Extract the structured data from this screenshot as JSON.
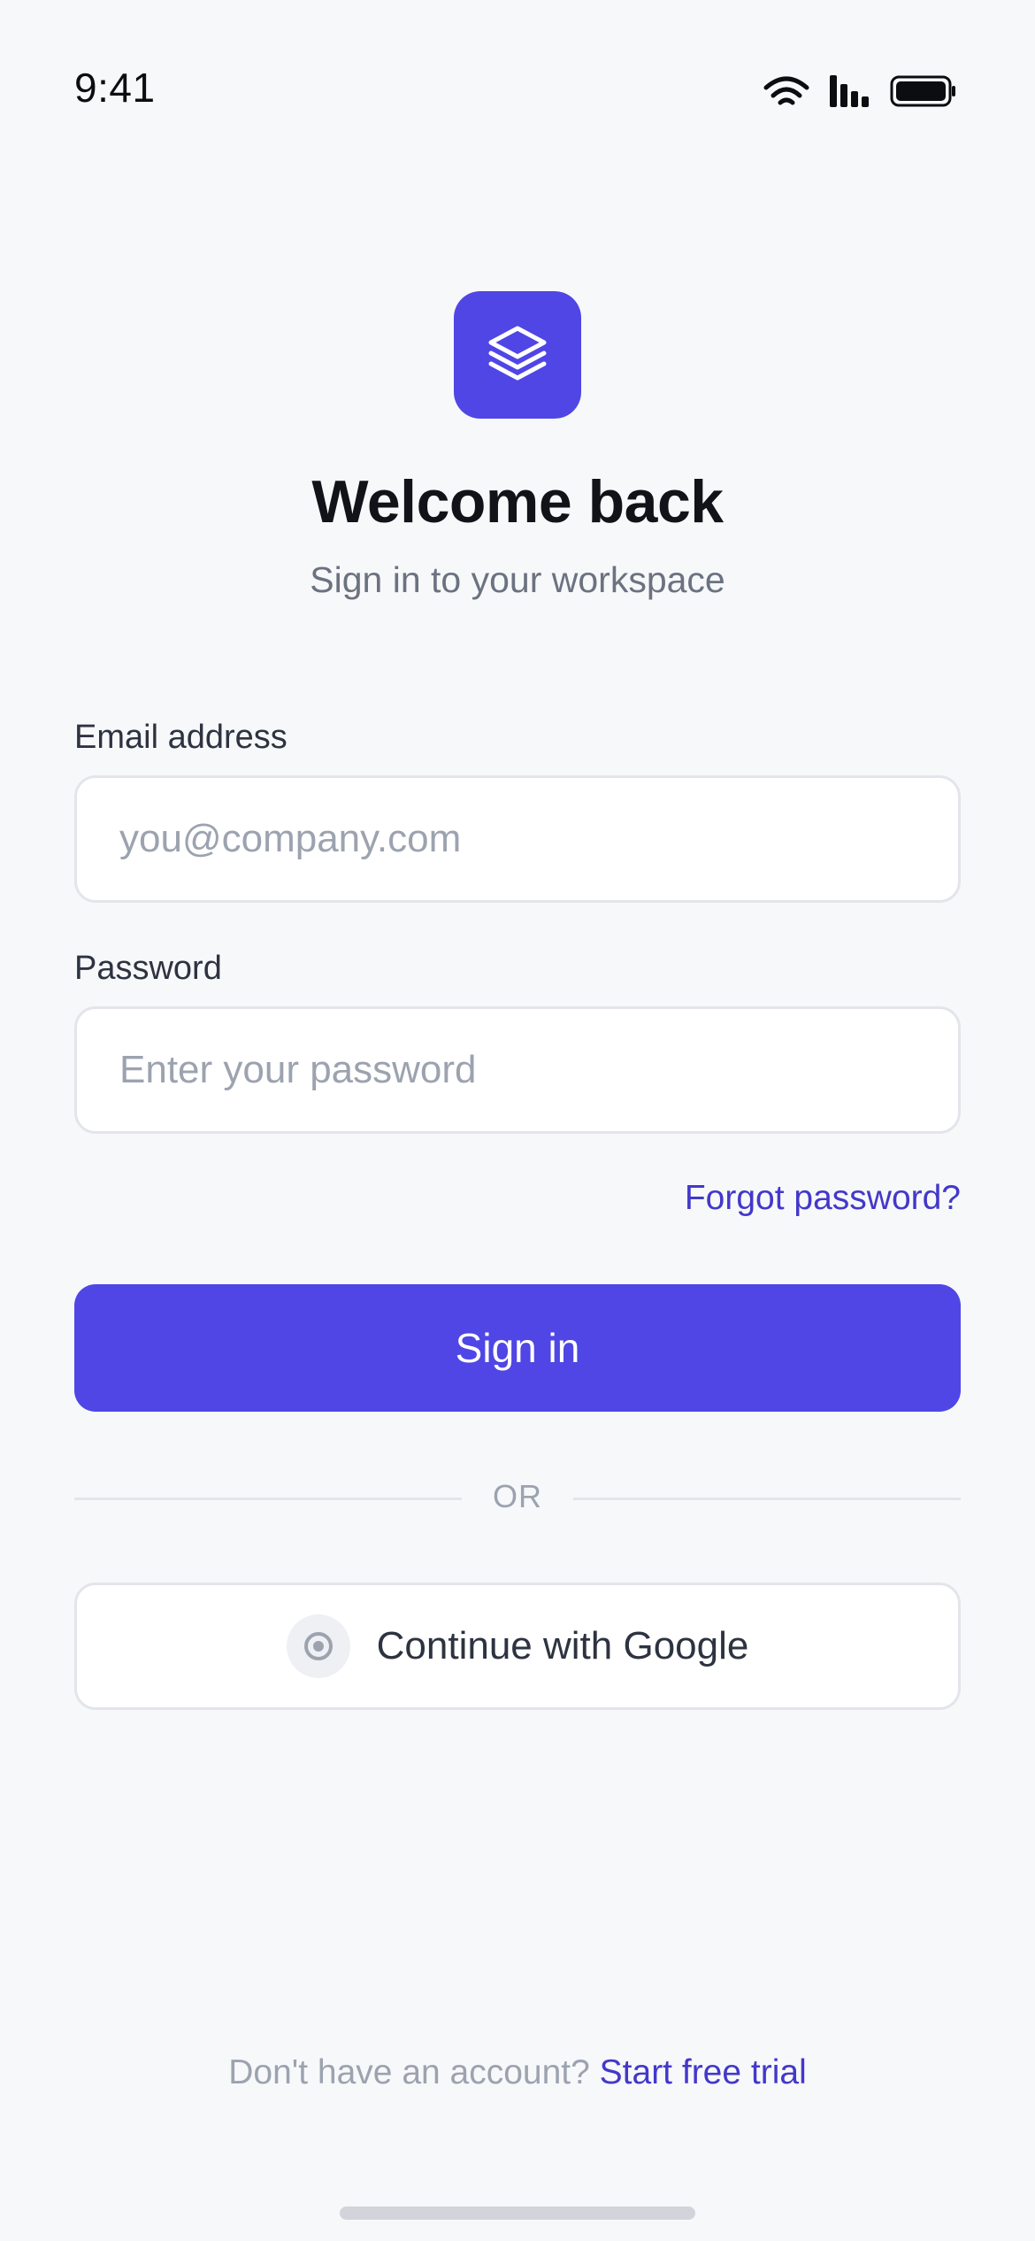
{
  "status_bar": {
    "time": "9:41",
    "icons": [
      "wifi-icon",
      "signal-icon",
      "battery-icon"
    ]
  },
  "brand": {
    "logo_icon": "layers-icon",
    "accent_color": "#4f46e5"
  },
  "header": {
    "title": "Welcome back",
    "subtitle": "Sign in to your workspace"
  },
  "form": {
    "email_label": "Email address",
    "email_placeholder": "you@company.com",
    "email_value": "",
    "password_label": "Password",
    "password_placeholder": "Enter your password",
    "password_value": "",
    "forgot_label": "Forgot password?",
    "submit_label": "Sign in"
  },
  "divider": {
    "text": "OR"
  },
  "social": {
    "google_label": "Continue with Google",
    "google_icon": "google-icon"
  },
  "footer": {
    "prompt": "Don't have an account?",
    "link_label": "Start free trial"
  }
}
